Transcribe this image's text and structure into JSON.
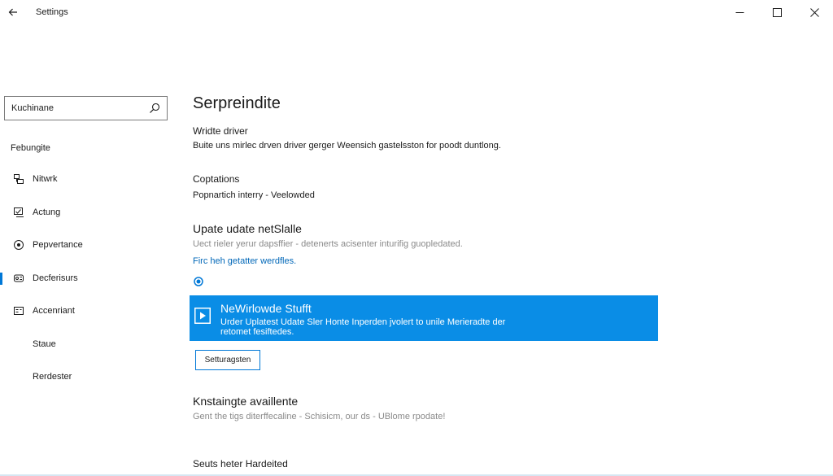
{
  "window": {
    "title": "Settings"
  },
  "sidebar": {
    "search_value": "Kuchinane",
    "section_label": "Febungite",
    "items": [
      {
        "label": "Nitwrk",
        "icon": "network-icon"
      },
      {
        "label": "Actung",
        "icon": "activity-icon"
      },
      {
        "label": "Pepvertance",
        "icon": "performance-icon"
      },
      {
        "label": "Decferisurs",
        "icon": "devices-icon"
      },
      {
        "label": "Accenriant",
        "icon": "account-icon"
      },
      {
        "label": "Staue",
        "icon": ""
      },
      {
        "label": "Rerdester",
        "icon": ""
      }
    ],
    "selected_index": 3
  },
  "main": {
    "page_title": "Serpreindite",
    "driver": {
      "heading": "Wridte driver",
      "text": "Buite uns mirlec drven driver gerger Weensich gastelsston for poodt duntlong."
    },
    "options": {
      "heading": "Coptations",
      "text": "Popnartich interry - Veelowded"
    },
    "update": {
      "heading": "Upate udate netSlalle",
      "text": "Uect rieler yerur dapsffier - detenerts acisenter inturifig guopledated.",
      "link": "Firc heh getatter werdfles."
    },
    "banner": {
      "title": "NeWirlowde Stufft",
      "desc": "Urder Uplatest Udate Sler Honte Inperden jvolert to unile Merieradte der retomet fesiftedes.",
      "color": "#0a8de6"
    },
    "button_label": "Setturagsten",
    "available": {
      "heading": "Knstaingte availlente",
      "text": "Gent the tigs diterffecaline - Schisicm, our ds - UBlome rpodate!"
    },
    "footer_heading": "Seuts heter Hardeited"
  },
  "colors": {
    "accent": "#0078d7",
    "link": "#0067b8"
  }
}
